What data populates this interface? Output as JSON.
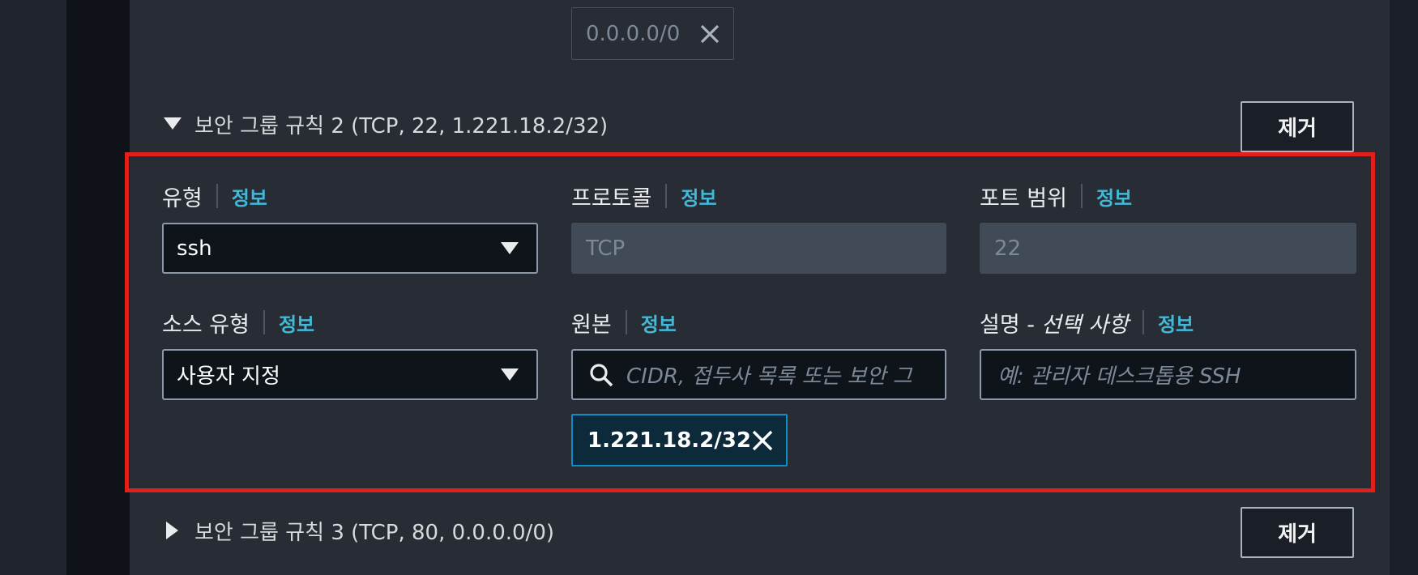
{
  "top_source_token": {
    "value": "0.0.0.0/0"
  },
  "rule2": {
    "header": "보안 그룹 규칙 2 (TCP, 22, 1.221.18.2/32)",
    "remove_label": "제거",
    "fields": {
      "type_label": "유형",
      "type_value": "ssh",
      "protocol_label": "프로토콜",
      "protocol_value": "TCP",
      "port_label": "포트 범위",
      "port_value": "22",
      "source_type_label": "소스 유형",
      "source_type_value": "사용자 지정",
      "source_label": "원본",
      "source_placeholder": "CIDR, 접두사 목록 또는 보안 그",
      "description_label": "설명 -",
      "description_optional": "선택 사항",
      "description_placeholder": "예: 관리자 데스크톱용 SSH",
      "info_link": "정보"
    },
    "source_token": "1.221.18.2/32"
  },
  "rule3": {
    "header": "보안 그룹 규칙 3 (TCP, 80, 0.0.0.0/0)",
    "remove_label": "제거"
  },
  "colors": {
    "highlight": "#e0201a",
    "info_link": "#44b9d6",
    "token_border": "#0a8fc7"
  },
  "icons": [
    "close-icon",
    "caret-down-icon",
    "caret-right-icon",
    "dropdown-arrow-icon",
    "search-icon"
  ]
}
